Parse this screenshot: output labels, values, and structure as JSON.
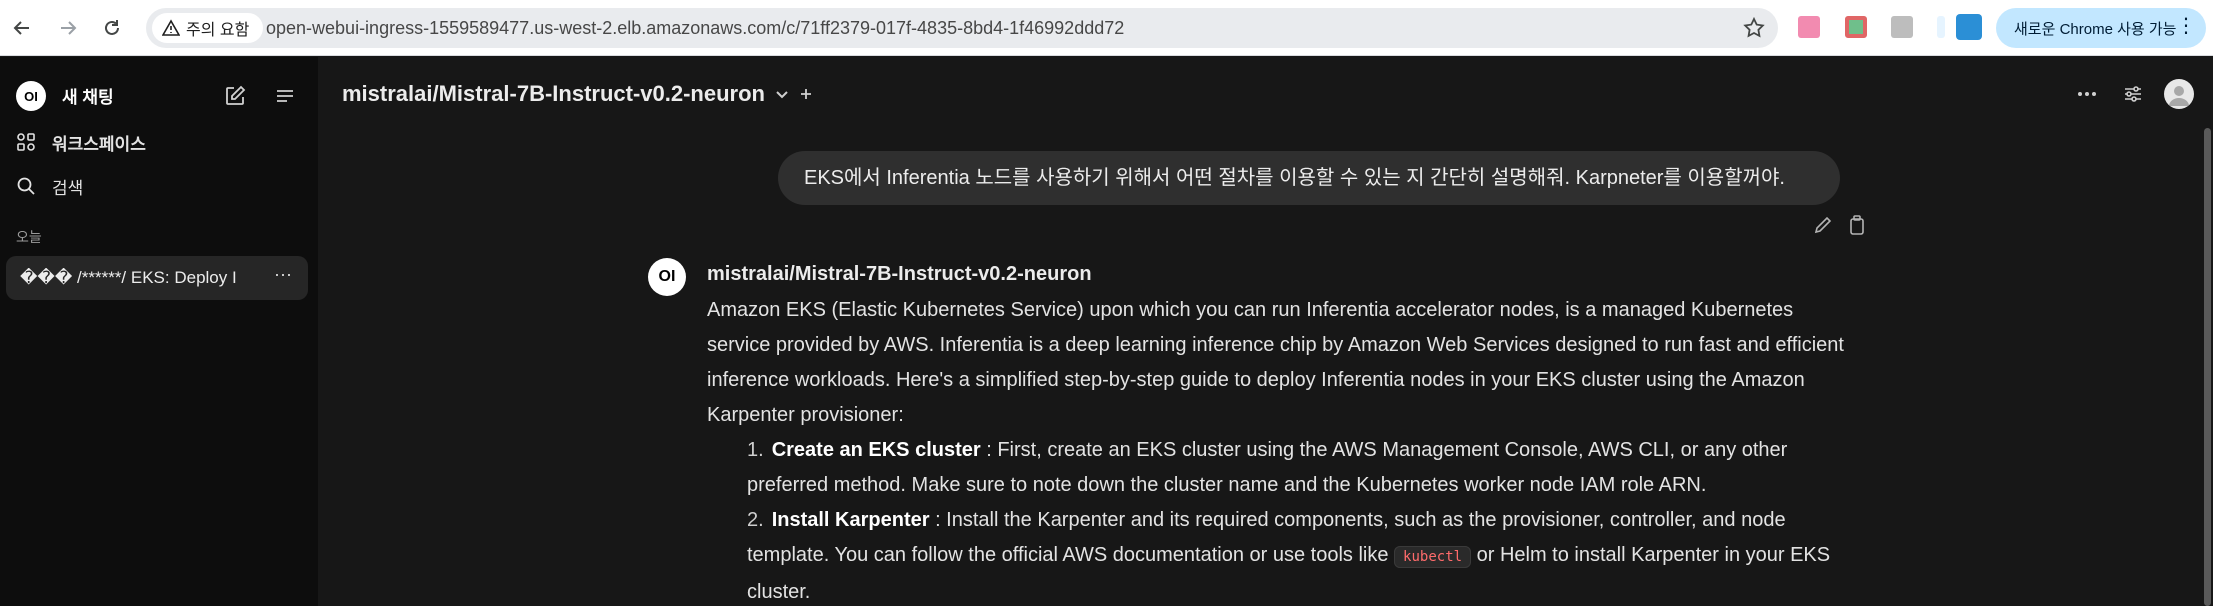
{
  "browser": {
    "warning_chip": "주의 요함",
    "url": "open-webui-ingress-1559589477.us-west-2.elb.amazonaws.com/c/71ff2379-017f-4835-8bd4-1f46992ddd72",
    "update_label": "새로운 Chrome 사용 가능",
    "more_icon": "⋮"
  },
  "sidebar": {
    "new_chat": "새 채팅",
    "workspace": "워크스페이스",
    "search": "검색",
    "section_today": "오늘",
    "chat_item": "��� /******/ EKS: Deploy I",
    "chat_more": "···",
    "logo_text": "OI"
  },
  "main": {
    "model_name": "mistralai/Mistral-7B-Instruct-v0.2-neuron",
    "user_message": "EKS에서 Inferentia 노드를 사용하기 위해서 어떤 절차를 이용할 수 있는 지 간단히 설명해줘. Karpneter를 이용할꺼야.",
    "assistant_name": "mistralai/Mistral-7B-Instruct-v0.2-neuron",
    "assistant_logo": "OI",
    "intro": "Amazon EKS (Elastic Kubernetes Service) upon which you can run Inferentia accelerator nodes, is a managed Kubernetes service provided by AWS. Inferentia is a deep learning inference chip by Amazon Web Services designed to run fast and efficient inference workloads. Here's a simplified step-by-step guide to deploy Inferentia nodes in your EKS cluster using the Amazon Karpenter provisioner:",
    "steps": [
      {
        "num": "1.",
        "title": "Create an EKS cluster",
        "text": " : First, create an EKS cluster using the AWS Management Console, AWS CLI, or any other preferred method. Make sure to note down the cluster name and the Kubernetes worker node IAM role ARN."
      },
      {
        "num": "2.",
        "title": "Install Karpenter",
        "text_before": " : Install the Karpenter and its required components, such as the provisioner, controller, and node template. You can follow the official AWS documentation or use tools like ",
        "code": "kubectl",
        "text_after": " or Helm to install Karpenter in your EKS cluster."
      }
    ]
  }
}
